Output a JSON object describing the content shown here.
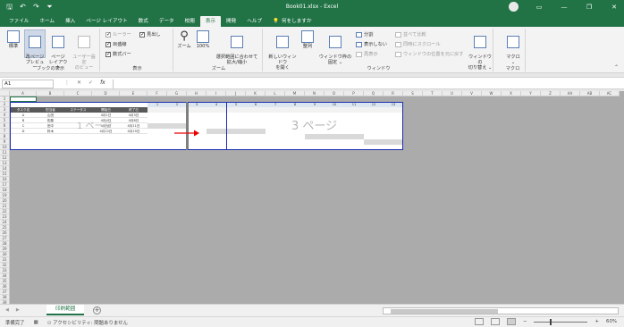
{
  "window": {
    "title": "Book01.xlsx  -  Excel",
    "quick_access": [
      "save-icon",
      "undo-icon",
      "redo-icon",
      "customize-icon"
    ],
    "controls": [
      "minimize",
      "restore",
      "close"
    ]
  },
  "tabs": [
    {
      "label": "ファイル"
    },
    {
      "label": "ホーム"
    },
    {
      "label": "挿入"
    },
    {
      "label": "ページ レイアウト"
    },
    {
      "label": "数式"
    },
    {
      "label": "データ"
    },
    {
      "label": "校閲"
    },
    {
      "label": "表示",
      "active": true
    },
    {
      "label": "開発"
    },
    {
      "label": "ヘルプ"
    }
  ],
  "tell_me": "何をしますか",
  "ribbon": {
    "workbook_views": {
      "label": "ブックの表示",
      "normal": "標準",
      "page_break": "改ページ\nプレビュー",
      "page_layout": "ページ\nレイアウト",
      "custom": "ユーザー設定\nのビュー"
    },
    "show": {
      "label": "表示",
      "ruler": "ルーラー",
      "gridlines": "目盛線",
      "formula_bar": "数式バー",
      "headings": "見出し"
    },
    "zoom": {
      "label": "ズーム",
      "zoom": "ズーム",
      "hundred": "100%",
      "selection": "選択範囲に合わせて\n拡大/縮小"
    },
    "window": {
      "label": "ウィンドウ",
      "new_window": "新しいウィンドウ\nを開く",
      "arrange": "整列",
      "freeze": "ウィンドウ枠の\n固定 ⌄",
      "split": "分割",
      "hide": "表示しない",
      "unhide": "再表示",
      "side_by_side": "並べて比較",
      "sync_scroll": "同時にスクロール",
      "reset_position": "ウィンドウの位置を元に戻す",
      "switch": "ウィンドウの\n切り替え ⌄"
    },
    "macros": {
      "label": "マクロ",
      "macro": "マクロ\n⌄"
    }
  },
  "formula_bar": {
    "name_box": "A1",
    "icons": [
      "⋮",
      "✕",
      "✓",
      "fx"
    ],
    "value": ""
  },
  "sheet": {
    "columns": [
      "A",
      "B",
      "C",
      "D",
      "E",
      "F",
      "G",
      "H",
      "I",
      "J",
      "K",
      "L",
      "M",
      "N",
      "O",
      "P",
      "Q",
      "R",
      "S",
      "T",
      "U",
      "V",
      "W",
      "X",
      "Y",
      "Z",
      "AA",
      "AB",
      "AC"
    ],
    "rows": [
      "1",
      "2",
      "3",
      "4",
      "5",
      "6",
      "7",
      "8",
      "9",
      "10",
      "11",
      "12",
      "13",
      "14",
      "15",
      "16",
      "17",
      "18",
      "19",
      "20",
      "21",
      "22",
      "23",
      "24",
      "25",
      "26",
      "27",
      "28",
      "29",
      "30",
      "31",
      "32",
      "33",
      "34",
      "35",
      "36",
      "37",
      "38",
      "39"
    ],
    "table_headers": [
      "タスク名",
      "担当者",
      "ステータス",
      "開始日",
      "終了日"
    ],
    "table_rows": [
      [
        "A",
        "山田",
        "",
        "4月1日",
        "4月3日"
      ],
      [
        "B",
        "佐藤",
        "",
        "4月4日",
        "4月8日"
      ],
      [
        "C",
        "田中",
        "",
        "4月9日",
        "4月11日"
      ],
      [
        "D",
        "鈴木",
        "",
        "4月12日",
        "4月15日"
      ]
    ],
    "day_numbers": [
      "1",
      "2",
      "3",
      "4",
      "5",
      "6",
      "7",
      "8",
      "9",
      "10",
      "11",
      "12",
      "13"
    ],
    "page_watermarks": [
      "1 ページ",
      "3 ページ"
    ]
  },
  "sheet_tabs": {
    "nav": [
      "◀",
      "▶"
    ],
    "active": "印刷範囲",
    "add": "+"
  },
  "status": {
    "ready": "準備完了",
    "accessibility": "アクセシビリティ: 問題ありません",
    "zoom": "60%"
  }
}
